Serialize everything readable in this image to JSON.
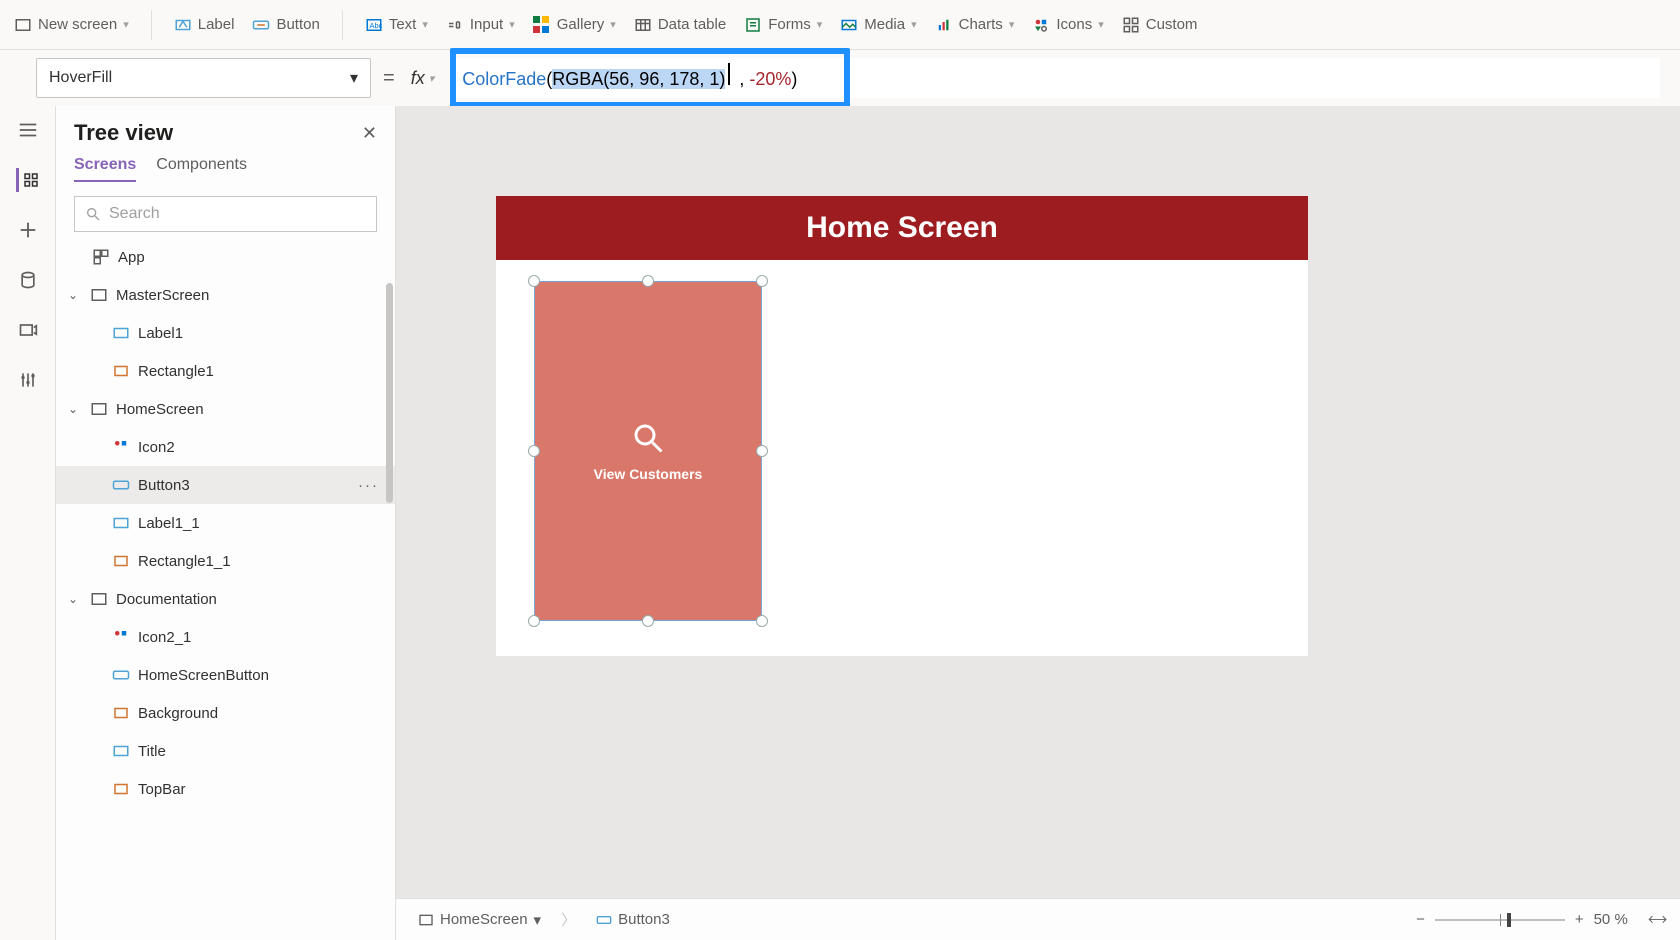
{
  "ribbon": {
    "new_screen": "New screen",
    "label": "Label",
    "button": "Button",
    "text": "Text",
    "input": "Input",
    "gallery": "Gallery",
    "data_table": "Data table",
    "forms": "Forms",
    "media": "Media",
    "charts": "Charts",
    "icons": "Icons",
    "custom": "Custom"
  },
  "formula": {
    "property": "HoverFill",
    "fx": "fx",
    "fn_name": "ColorFade",
    "open_paren": "(",
    "arg_selected": "RGBA(56, 96, 178, 1)",
    "comma": ", ",
    "arg_pct": "-20%",
    "close_paren": ")"
  },
  "tree": {
    "title": "Tree view",
    "tab_screens": "Screens",
    "tab_components": "Components",
    "search_placeholder": "Search",
    "app": "App",
    "master_screen": "MasterScreen",
    "label1": "Label1",
    "rectangle1": "Rectangle1",
    "home_screen": "HomeScreen",
    "icon2": "Icon2",
    "button3": "Button3",
    "label1_1": "Label1_1",
    "rectangle1_1": "Rectangle1_1",
    "documentation": "Documentation",
    "icon2_1": "Icon2_1",
    "home_screen_button": "HomeScreenButton",
    "background": "Background",
    "title_item": "Title",
    "topbar": "TopBar"
  },
  "canvas": {
    "screen_title": "Home Screen",
    "button_card_label": "View Customers"
  },
  "status": {
    "bc_screen": "HomeScreen",
    "bc_control": "Button3",
    "zoom_pct": "50 %"
  }
}
